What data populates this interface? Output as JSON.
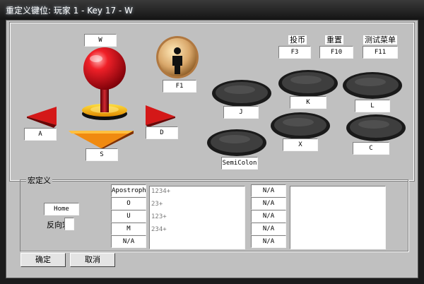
{
  "window": {
    "title": "重定义键位: 玩家 1 - Key 17 - W"
  },
  "joystick": {
    "up": "W",
    "left": "A",
    "right": "D",
    "down": "S"
  },
  "player_button": {
    "key": "F1"
  },
  "system_keys": [
    {
      "label": "投币",
      "key": "F3"
    },
    {
      "label": "重置",
      "key": "F10"
    },
    {
      "label": "测试菜单",
      "key": "F11"
    }
  ],
  "action_buttons": [
    {
      "key": "J"
    },
    {
      "key": "K"
    },
    {
      "key": "L"
    },
    {
      "key": "SemiColon"
    },
    {
      "key": "X"
    },
    {
      "key": "C"
    }
  ],
  "macro": {
    "group_label": "宏定义",
    "trigger_key": "Home",
    "reverse_label": "反向宏",
    "keys_left": [
      "Apostroph",
      "O",
      "U",
      "M",
      "N/A"
    ],
    "sequence_lines": [
      "1234+",
      "23+",
      "123+",
      "234+"
    ],
    "keys_right": [
      "N/A",
      "N/A",
      "N/A",
      "N/A",
      "N/A"
    ]
  },
  "footer": {
    "ok_label": "确定",
    "cancel_label": "取消"
  },
  "colors": {
    "title_bar": "#1c1c1c",
    "dialog_bg": "#c0c0c0",
    "ball_red": "#d8101c",
    "arrow_red": "#d41818",
    "arrow_orange": "#f08010"
  }
}
